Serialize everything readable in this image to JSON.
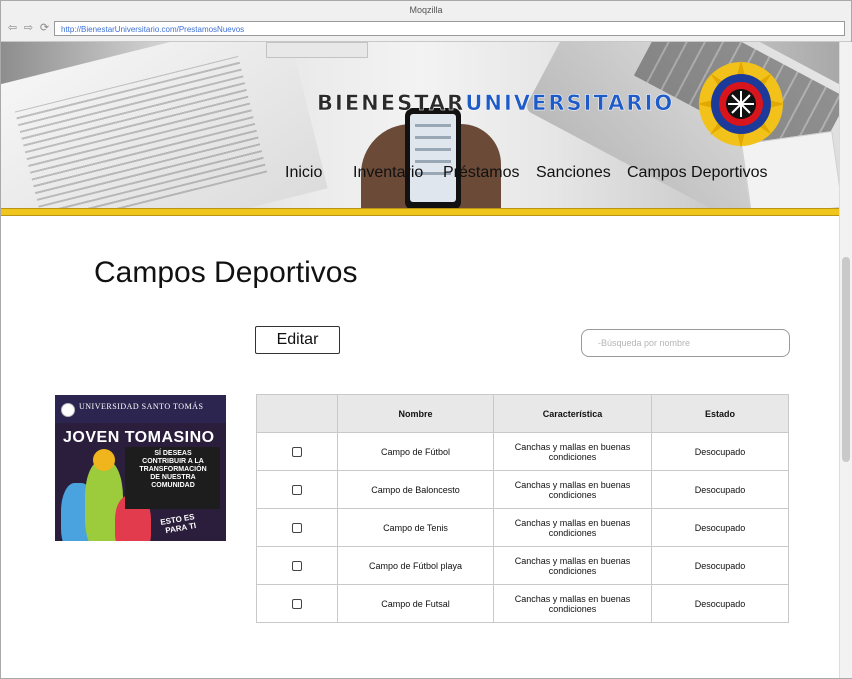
{
  "browser": {
    "title": "Moqzilla",
    "url": "http://BienestarUniversitario.com/PrestamosNuevos",
    "nav_icons": [
      "back-arrow-icon",
      "forward-arrow-icon",
      "reload-icon"
    ]
  },
  "header": {
    "brand_part1": "BIENESTAR",
    "brand_part2": "UNIVERSITARIO",
    "colors": {
      "brand_dark": "#2a2a2a",
      "brand_blue": "#1e5bc7",
      "accent_bar": "#f0c51e"
    },
    "nav": [
      {
        "label": "Inicio"
      },
      {
        "label": "Inventario"
      },
      {
        "label": "Préstamos"
      },
      {
        "label": "Sanciones"
      },
      {
        "label": "Campos Deportivos"
      }
    ]
  },
  "main": {
    "title": "Campos Deportivos",
    "edit_button": "Editar",
    "search_placeholder": "-Búsqueda por nombre",
    "promo": {
      "university": "UNIVERSIDAD SANTO TOMÁS",
      "title": "JOVEN TOMASINO",
      "message": "SÍ DESEAS\nCONTRIBUIR A LA\nTRANSFORMACIÓN\nDE NUESTRA\nCOMUNIDAD",
      "footer": "ESTO ES\nPARA TI"
    },
    "table": {
      "headers": [
        "",
        "Nombre",
        "Característica",
        "Estado"
      ],
      "rows": [
        {
          "nombre": "Campo de Fútbol",
          "caracteristica": "Canchas y mallas en buenas condiciones",
          "estado": "Desocupado",
          "checked": false
        },
        {
          "nombre": "Campo de Baloncesto",
          "caracteristica": "Canchas y mallas en buenas condiciones",
          "estado": "Desocupado",
          "checked": false
        },
        {
          "nombre": "Campo de Tenis",
          "caracteristica": "Canchas y mallas en buenas condiciones",
          "estado": "Desocupado",
          "checked": false
        },
        {
          "nombre": "Campo de Fútbol playa",
          "caracteristica": "Canchas y mallas en buenas condiciones",
          "estado": "Desocupado",
          "checked": false
        },
        {
          "nombre": "Campo de Futsal",
          "caracteristica": "Canchas y mallas en buenas condiciones",
          "estado": "Desocupado",
          "checked": false
        }
      ]
    }
  }
}
